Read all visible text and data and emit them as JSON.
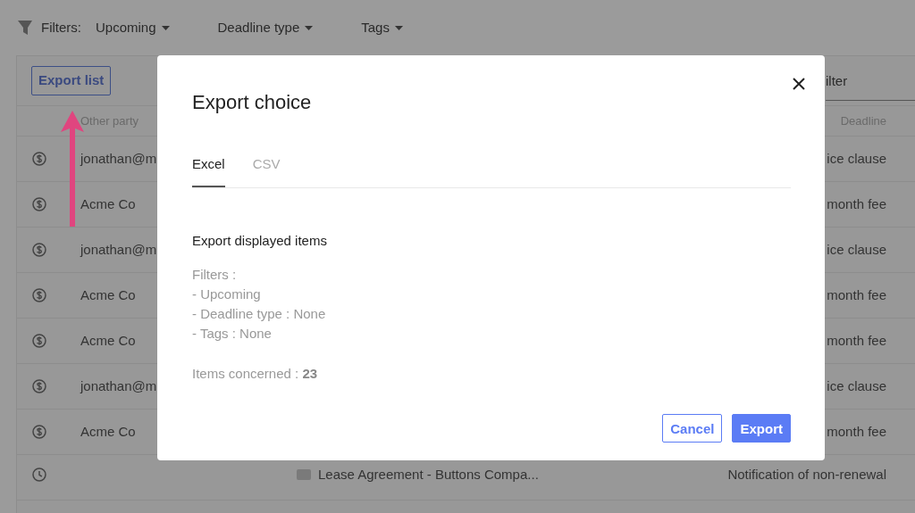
{
  "filters": {
    "label": "Filters:",
    "dropdowns": [
      "Upcoming",
      "Deadline type",
      "Tags"
    ]
  },
  "toolbar": {
    "export_button": "Export list",
    "filter_field": {
      "placeholder": "ilter"
    }
  },
  "table": {
    "columns": [
      "Other party",
      "Deadline"
    ],
    "rows": [
      {
        "kind": "payment",
        "other_party": "jonathan@m",
        "deadline": "ice clause"
      },
      {
        "kind": "payment",
        "other_party": "Acme Co",
        "deadline": "month fee"
      },
      {
        "kind": "payment",
        "other_party": "jonathan@m",
        "deadline": "ice clause"
      },
      {
        "kind": "payment",
        "other_party": "Acme Co",
        "deadline": "month fee"
      },
      {
        "kind": "payment",
        "other_party": "Acme Co",
        "deadline": "month fee"
      },
      {
        "kind": "payment",
        "other_party": "jonathan@m",
        "deadline": "ice clause"
      },
      {
        "kind": "payment",
        "other_party": "Acme Co",
        "deadline": "month fee"
      },
      {
        "kind": "reminder",
        "document": "Lease Agreement - Buttons Compa...",
        "deadline": "Notification of non-renewal"
      }
    ]
  },
  "modal": {
    "title": "Export choice",
    "tabs": [
      {
        "label": "Excel",
        "selected": true
      },
      {
        "label": "CSV",
        "selected": false
      }
    ],
    "heading": "Export displayed items",
    "details": [
      "Filters :",
      "- Upcoming",
      "- Deadline type : None",
      "- Tags : None"
    ],
    "count": "Items concerned : **23**",
    "buttons": [
      {
        "label": "Cancel",
        "kind": "secondary"
      },
      {
        "label": "Export",
        "kind": "primary"
      }
    ]
  }
}
